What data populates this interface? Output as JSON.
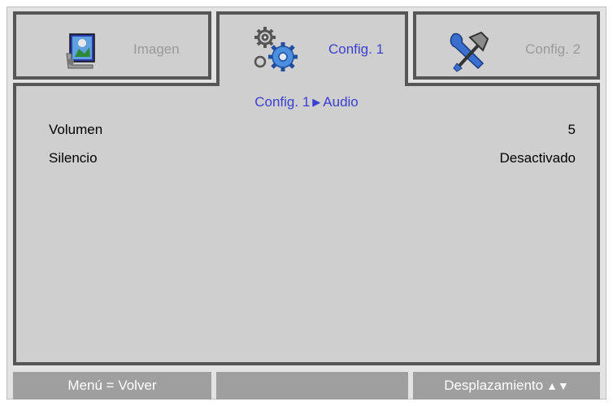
{
  "tabs": [
    {
      "label": "Imagen",
      "icon": "image-settings-icon",
      "active": false
    },
    {
      "label": "Config. 1",
      "icon": "gears-icon",
      "active": true
    },
    {
      "label": "Config. 2",
      "icon": "tools-icon",
      "active": false
    }
  ],
  "breadcrumb": {
    "parent": "Config. 1",
    "separator": "▶",
    "current": "Audio"
  },
  "settings": [
    {
      "label": "Volumen",
      "value": "5"
    },
    {
      "label": "Silencio",
      "value": "Desactivado"
    }
  ],
  "footer": {
    "left": "Menú = Volver",
    "middle": "",
    "right": "Desplazamiento",
    "right_arrows": "▲▼"
  },
  "colors": {
    "active_text": "#3a40d0",
    "inactive_text": "#9a9a9a",
    "panel_bg": "#cfcfcf",
    "border": "#565656",
    "footer_bg": "#9f9f9f"
  }
}
